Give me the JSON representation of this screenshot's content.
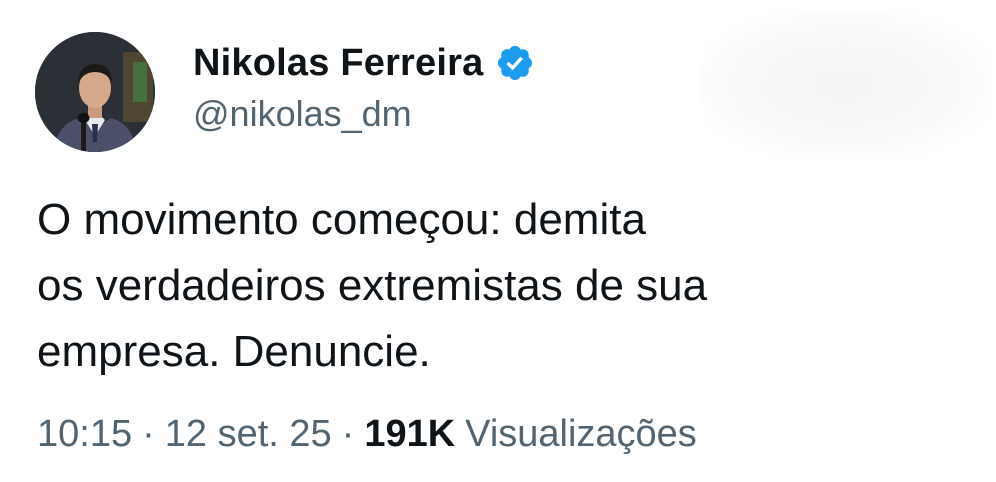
{
  "author": {
    "display_name": "Nikolas Ferreira",
    "handle": "@nikolas_dm",
    "verified_icon": "verified-badge-icon",
    "avatar_icon": "avatar"
  },
  "tweet": {
    "lines": [
      "O movimento começou: demita",
      "os verdadeiros extremistas de sua",
      "empresa. Denuncie."
    ]
  },
  "meta": {
    "time": "10:15",
    "separator": "·",
    "date": "12 set. 25",
    "views_count": "191K",
    "views_label": "Visualizações"
  },
  "colors": {
    "text_primary": "#0f1419",
    "text_secondary": "#536471",
    "verified_blue": "#1d9bf0"
  }
}
